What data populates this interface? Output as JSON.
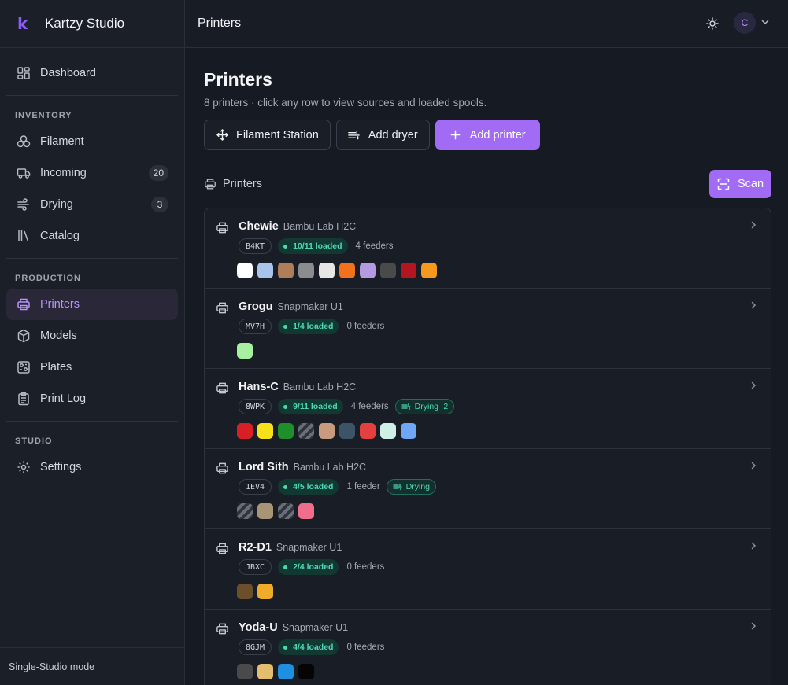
{
  "app": {
    "name": "Kartzy Studio",
    "logo_letter": "k",
    "accent": "#a26bf3"
  },
  "sidebar": {
    "dashboard": {
      "label": "Dashboard",
      "icon": "dashboard-icon"
    },
    "inventory_heading": "INVENTORY",
    "inventory": [
      {
        "label": "Filament",
        "icon": "filament-icon"
      },
      {
        "label": "Incoming",
        "icon": "truck-icon",
        "badge": "20"
      },
      {
        "label": "Drying",
        "icon": "wind-icon",
        "badge": "3"
      },
      {
        "label": "Catalog",
        "icon": "books-icon"
      }
    ],
    "production_heading": "PRODUCTION",
    "production": [
      {
        "label": "Printers",
        "icon": "printer-icon",
        "active": true
      },
      {
        "label": "Models",
        "icon": "cube-icon"
      },
      {
        "label": "Plates",
        "icon": "plate-icon"
      },
      {
        "label": "Print Log",
        "icon": "clipboard-icon"
      }
    ],
    "studio_heading": "STUDIO",
    "studio": [
      {
        "label": "Settings",
        "icon": "gear-icon"
      }
    ],
    "footer": "Single-Studio mode"
  },
  "topbar": {
    "title": "Printers",
    "avatar_initial": "C"
  },
  "page": {
    "title": "Printers",
    "subtitle": "8 printers · click any row to view sources and loaded spools.",
    "actions": {
      "filament_station": "Filament Station",
      "add_dryer": "Add dryer",
      "add_printer": "Add printer"
    },
    "section_label": "Printers",
    "scan_label": "Scan"
  },
  "printers": [
    {
      "name": "Chewie",
      "model": "Bambu Lab H2C",
      "code": "B4KT",
      "loaded": "10/11 loaded",
      "feeders": "4 feeders",
      "drying": "",
      "swatches": [
        "#ffffff",
        "#a9c4ec",
        "#b07d5a",
        "#8a8c90",
        "#e6e6e4",
        "#f2711c",
        "#b49ae0",
        "#4a4a4a",
        "#b3161f",
        "#f59a1e"
      ]
    },
    {
      "name": "Grogu",
      "model": "Snapmaker U1",
      "code": "MV7H",
      "loaded": "1/4 loaded",
      "feeders": "0 feeders",
      "drying": "",
      "swatches": [
        "#a6f0a0"
      ]
    },
    {
      "name": "Hans-C",
      "model": "Bambu Lab H2C",
      "code": "8WPK",
      "loaded": "9/11 loaded",
      "feeders": "4 feeders",
      "drying": "Drying ·2",
      "swatches": [
        "#d81f26",
        "#f7e11a",
        "#1e8f2a",
        "striped",
        "#c99b7e",
        "#3d5468",
        "#e4403f",
        "#d0efe6",
        "#6ea7f5"
      ]
    },
    {
      "name": "Lord Sith",
      "model": "Bambu Lab H2C",
      "code": "1EV4",
      "loaded": "4/5 loaded",
      "feeders": "1 feeder",
      "drying": "Drying",
      "swatches": [
        "striped",
        "#a89576",
        "striped",
        "#f06d8b"
      ]
    },
    {
      "name": "R2-D1",
      "model": "Snapmaker U1",
      "code": "JBXC",
      "loaded": "2/4 loaded",
      "feeders": "0 feeders",
      "drying": "",
      "swatches": [
        "#6b4f2a",
        "#f0ab2a"
      ]
    },
    {
      "name": "Yoda-U",
      "model": "Snapmaker U1",
      "code": "8GJM",
      "loaded": "4/4 loaded",
      "feeders": "0 feeders",
      "drying": "",
      "swatches": [
        "#4a4a4a",
        "#e5bd6e",
        "#1f8fe0",
        "#050505"
      ]
    }
  ]
}
